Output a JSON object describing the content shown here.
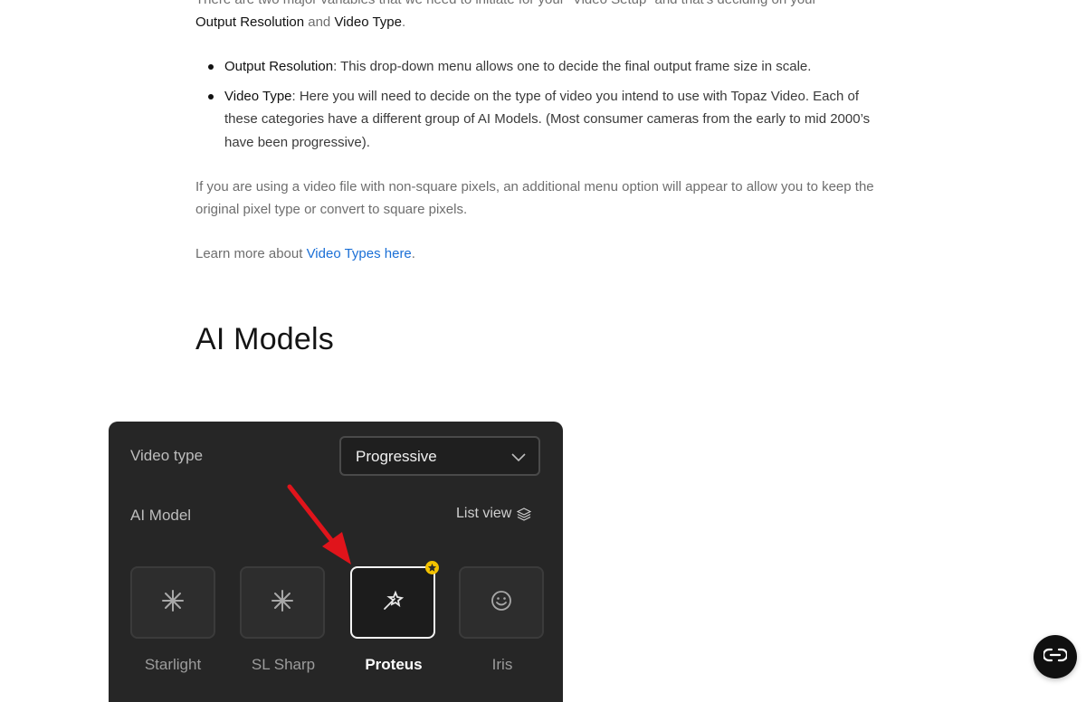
{
  "intro": {
    "text_start": "There are two major variables that we need to initiate for your “Video Setup” and that’s deciding on your",
    "term_resolution": "Output Resolution",
    "and": " and ",
    "term_video_type": "Video Type",
    "end": "."
  },
  "bullets": [
    {
      "term": "Output Resolution",
      "text": ": This drop-down menu allows one to decide the final output frame size in scale."
    },
    {
      "term": "Video Type",
      "text": ": Here you will need to decide on the type of video you intend to use with Topaz Video. Each of these categories have a different group of AI Models. (Most consumer cameras from the early to mid 2000’s have been progressive)."
    }
  ],
  "pixels_note": "If you are using a video file with non-square pixels, an additional menu option will appear to allow you to keep the original pixel type or convert to square pixels.",
  "learn_more": {
    "prefix": "Learn more about ",
    "link_text": "Video Types here",
    "suffix": "."
  },
  "section_title": "AI Models",
  "screenshot": {
    "video_type_label": "Video type",
    "video_type_value": "Progressive",
    "ai_model_label": "AI Model",
    "list_view_label": "List view",
    "models": [
      {
        "name": "Starlight",
        "icon": "sparkle-icon"
      },
      {
        "name": "SL Sharp",
        "icon": "sparkle-icon"
      },
      {
        "name": "Proteus",
        "icon": "magic-wand-icon",
        "selected": true
      },
      {
        "name": "Iris",
        "icon": "smiley-face-icon"
      }
    ]
  },
  "colors": {
    "link": "#1a6fd6",
    "panel_bg": "#262626",
    "arrow": "#e0141b",
    "badge": "#f3c200"
  }
}
